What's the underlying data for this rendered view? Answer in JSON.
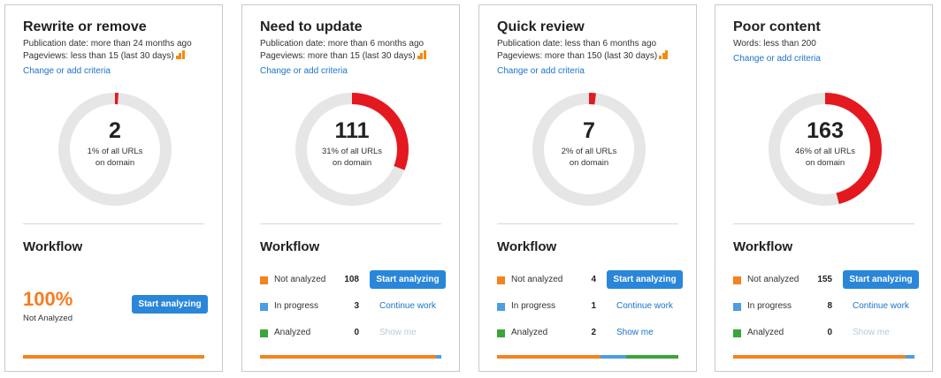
{
  "colors": {
    "accent_red": "#e3191f",
    "ring_gray": "#e6e6e6",
    "not_analyzed": "#f58220",
    "in_progress": "#4a9ee3",
    "analyzed": "#3aa53a",
    "link": "#1a73c9",
    "button": "#2a86d9"
  },
  "cards": [
    {
      "title": "Rewrite or remove",
      "criteria": [
        "Publication date: more than 24 months ago",
        "Pageviews: less than 15 (last 30 days)"
      ],
      "change_link": "Change or add criteria",
      "count": "2",
      "percent_of_domain": 1,
      "sub1": "1% of all URLs",
      "sub2": "on domain",
      "workflow_title": "Workflow",
      "single_status": {
        "percent": "100%",
        "label": "Not Analyzed",
        "button": "Start analyzing"
      },
      "bar": {
        "not_analyzed": 1.0,
        "in_progress": 0,
        "analyzed": 0
      }
    },
    {
      "title": "Need to update",
      "criteria": [
        "Publication date: more than 6 months ago",
        "Pageviews: more than 15 (last 30 days)"
      ],
      "change_link": "Change or add criteria",
      "count": "111",
      "percent_of_domain": 31,
      "sub1": "31% of all URLs",
      "sub2": "on domain",
      "workflow_title": "Workflow",
      "rows": [
        {
          "label": "Not analyzed",
          "count": "108",
          "action": "Start analyzing",
          "type": "button"
        },
        {
          "label": "In progress",
          "count": "3",
          "action": "Continue work",
          "type": "link"
        },
        {
          "label": "Analyzed",
          "count": "0",
          "action": "Show me",
          "type": "disabled"
        }
      ],
      "bar": {
        "not_analyzed": 0.973,
        "in_progress": 0.027,
        "analyzed": 0
      }
    },
    {
      "title": "Quick review",
      "criteria": [
        "Publication date: less than 6 months ago",
        "Pageviews: more than 150 (last 30 days)"
      ],
      "change_link": "Change or add criteria",
      "count": "7",
      "percent_of_domain": 2,
      "sub1": "2% of all URLs",
      "sub2": "on domain",
      "workflow_title": "Workflow",
      "rows": [
        {
          "label": "Not analyzed",
          "count": "4",
          "action": "Start analyzing",
          "type": "button"
        },
        {
          "label": "In progress",
          "count": "1",
          "action": "Continue work",
          "type": "link"
        },
        {
          "label": "Analyzed",
          "count": "2",
          "action": "Show me",
          "type": "link"
        }
      ],
      "bar": {
        "not_analyzed": 0.571,
        "in_progress": 0.143,
        "analyzed": 0.286
      }
    },
    {
      "title": "Poor content",
      "criteria": [
        "Words: less than 200"
      ],
      "change_link": "Change or add criteria",
      "count": "163",
      "percent_of_domain": 46,
      "sub1": "46% of all URLs",
      "sub2": "on domain",
      "workflow_title": "Workflow",
      "rows": [
        {
          "label": "Not analyzed",
          "count": "155",
          "action": "Start analyzing",
          "type": "button"
        },
        {
          "label": "In progress",
          "count": "8",
          "action": "Continue work",
          "type": "link"
        },
        {
          "label": "Analyzed",
          "count": "0",
          "action": "Show me",
          "type": "disabled"
        }
      ],
      "bar": {
        "not_analyzed": 0.951,
        "in_progress": 0.049,
        "analyzed": 0
      }
    }
  ]
}
